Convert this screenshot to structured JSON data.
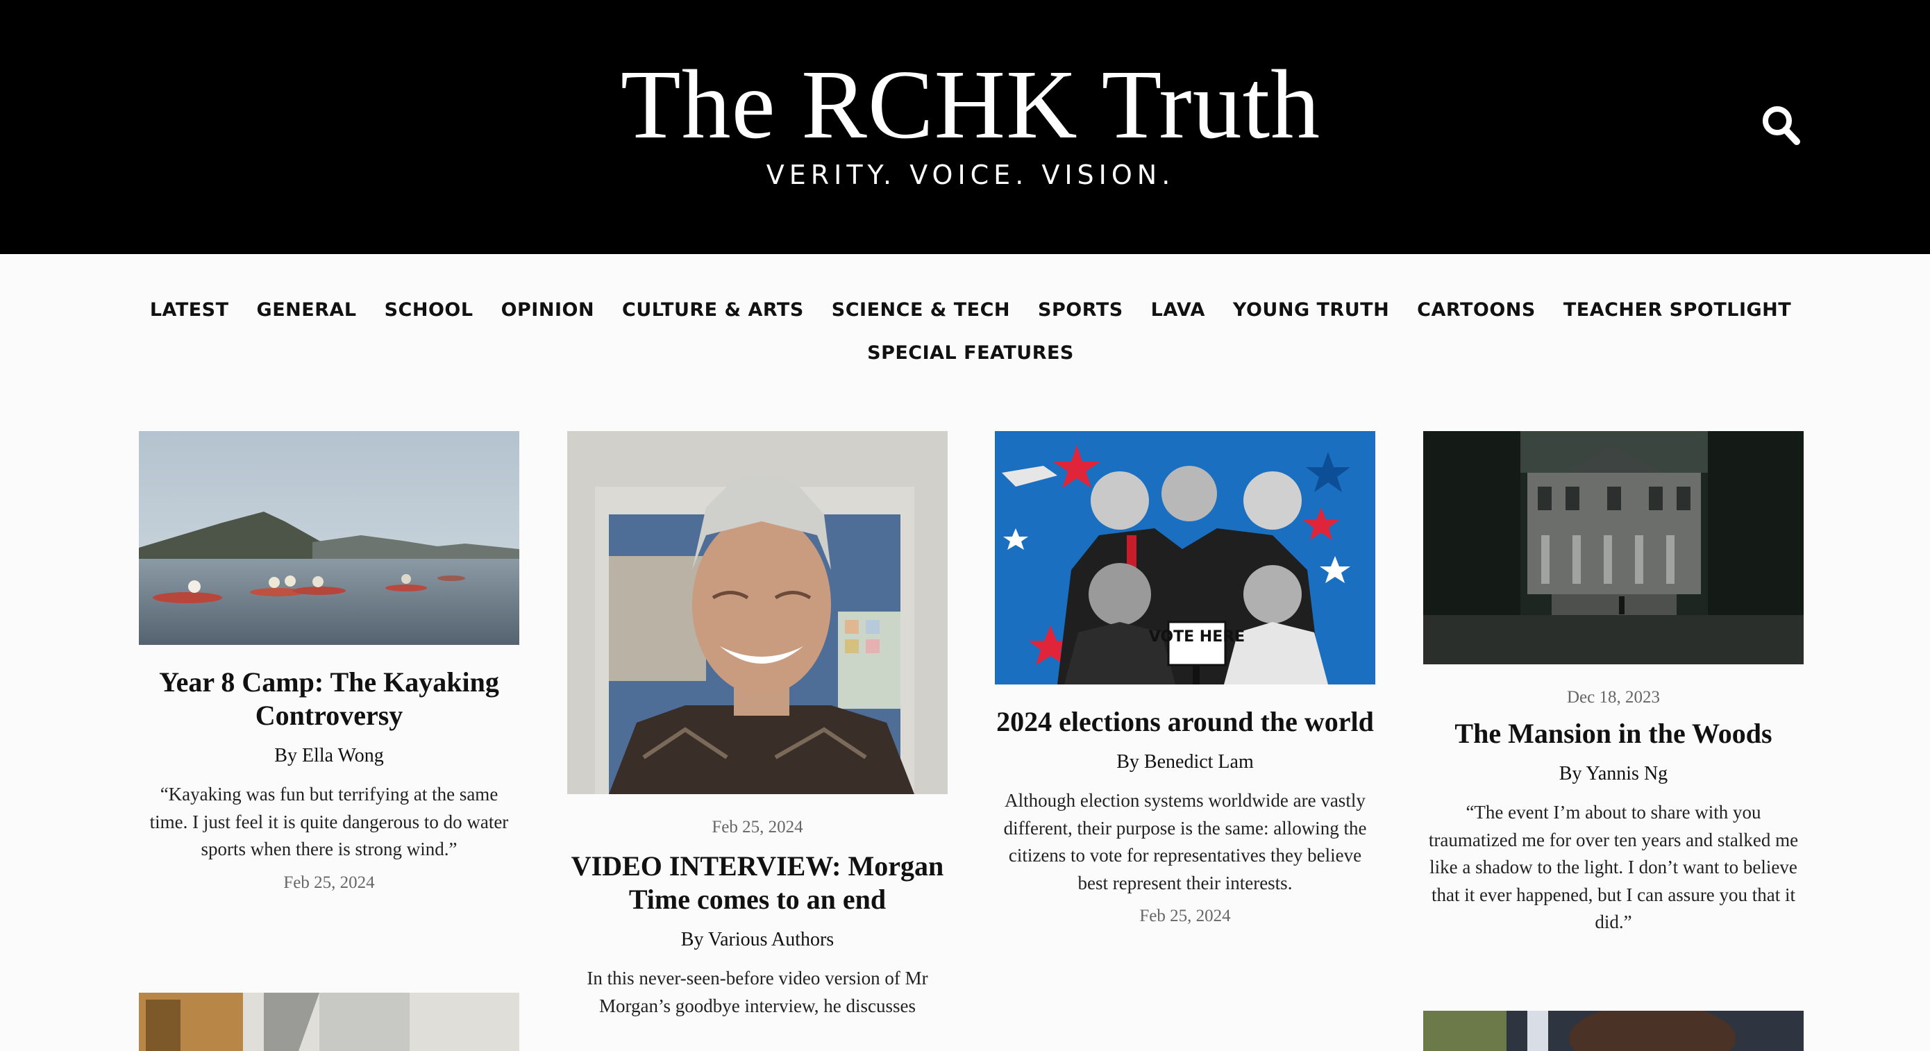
{
  "site": {
    "title": "The RCHK Truth",
    "tagline": "VERITY. VOICE. VISION."
  },
  "nav": {
    "row1": [
      "LATEST",
      "GENERAL",
      "SCHOOL",
      "OPINION",
      "CULTURE & ARTS",
      "SCIENCE & TECH",
      "SPORTS",
      "LAVA",
      "YOUNG TRUTH",
      "CARTOONS",
      "TEACHER SPOTLIGHT"
    ],
    "row2": [
      "SPECIAL FEATURES"
    ]
  },
  "articles": [
    {
      "title": "Year 8 Camp: The Kayaking Controversy",
      "byline": "By Ella Wong",
      "excerpt": "“Kayaking was fun but terrifying at the same time. I just feel it is quite dangerous to do water sports when there is strong wind.”",
      "date": "Feb 25, 2024"
    },
    {
      "title": "VIDEO INTERVIEW: Morgan Time comes to an end",
      "byline": "By Various Authors",
      "excerpt": "In this never-seen-before video version of Mr Morgan’s goodbye interview, he discusses",
      "date": "Feb 25, 2024"
    },
    {
      "title": "2024 elections around the world",
      "byline": "By Benedict Lam",
      "excerpt": "Although election systems worldwide are vastly different, their purpose is the same: allowing the citizens to vote for representatives they believe best represent their interests.",
      "date": "Feb 25, 2024"
    },
    {
      "title": "The Mansion in the Woods",
      "byline": "By Yannis Ng",
      "excerpt": "“The event I’m about to share with you traumatized me for over ten years and stalked me like a shadow to the light. I don’t want to believe that it ever happened, but I can assure you that it did.”",
      "date": "Dec 18, 2023"
    }
  ],
  "poster": {
    "sign_text": "VOTE HERE"
  },
  "colors": {
    "header_bg": "#000000",
    "page_bg": "#fbfbfb",
    "poster_blue": "#1a6fc0",
    "star_red": "#e0253a"
  }
}
